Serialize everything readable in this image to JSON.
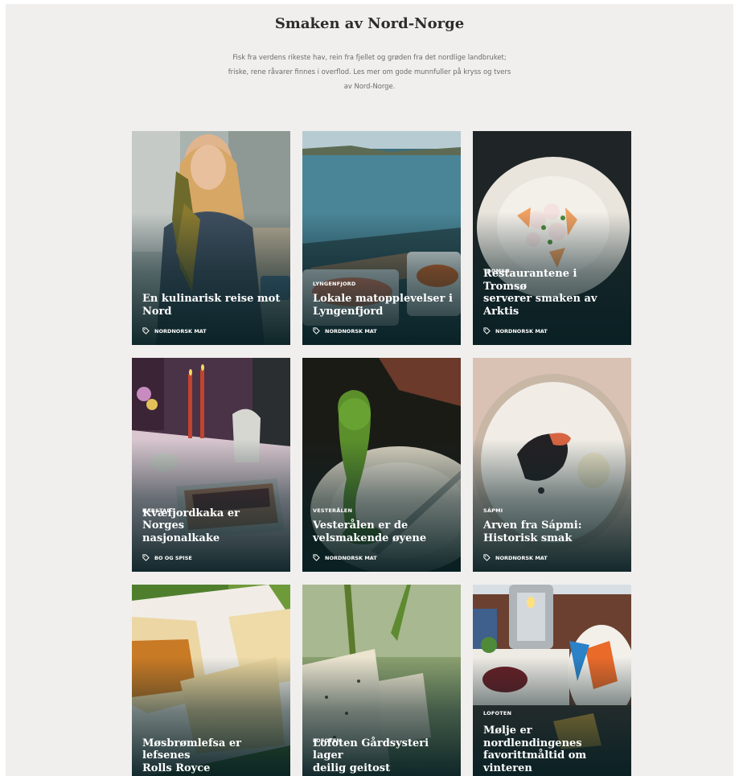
{
  "section": {
    "title": "Smaken av Nord-Norge",
    "intro_lines": [
      "Fisk fra verdens rikeste hav, rein fra fjellet og grøden fra det nordlige landbruket;",
      "friske, rene råvarer finnes i overflod. Les mer om gode munnfuller på kryss og tvers",
      "av Nord-Norge."
    ]
  },
  "cards": [
    {
      "region": "",
      "title_lines": [
        "En kulinarisk reise mot",
        "Nord"
      ],
      "tag": "NORDNORSK MAT",
      "icon": "tag-icon"
    },
    {
      "region": "LYNGENFJORD",
      "title_lines": [
        "Lokale matopplevelser i",
        "Lyngenfjord"
      ],
      "tag": "NORDNORSK MAT",
      "icon": "tag-icon"
    },
    {
      "region": "TROMSØ",
      "title_lines": [
        "Restaurantene i Tromsø",
        "serverer smaken av",
        "Arktis"
      ],
      "tag": "NORDNORSK MAT",
      "icon": "tag-icon"
    },
    {
      "region": "HARSTAD",
      "title_lines": [
        "Kvæfjordkaka er Norges",
        "nasjonalkake"
      ],
      "tag": "BO OG SPISE",
      "icon": "tag-icon"
    },
    {
      "region": "VESTERÅLEN",
      "title_lines": [
        "Vesterålen er de",
        "velsmakende øyene"
      ],
      "tag": "NORDNORSK MAT",
      "icon": "tag-icon"
    },
    {
      "region": "SÁPMI",
      "title_lines": [
        "Arven fra Sápmi:",
        "Historisk smak"
      ],
      "tag": "NORDNORSK MAT",
      "icon": "tag-icon"
    },
    {
      "region": "",
      "title_lines": [
        "Møsbrømlefsa er lefsenes",
        "Rolls Royce"
      ],
      "tag": "",
      "icon": ""
    },
    {
      "region": "LOFOTEN",
      "title_lines": [
        "Lofoten Gårdsysteri lager",
        "deilig geitost"
      ],
      "tag": "",
      "icon": ""
    },
    {
      "region": "LOFOTEN",
      "title_lines": [
        "Mølje er",
        "nordlendingenes",
        "favorittmåltid om",
        "vinteren"
      ],
      "tag": "",
      "icon": ""
    }
  ]
}
